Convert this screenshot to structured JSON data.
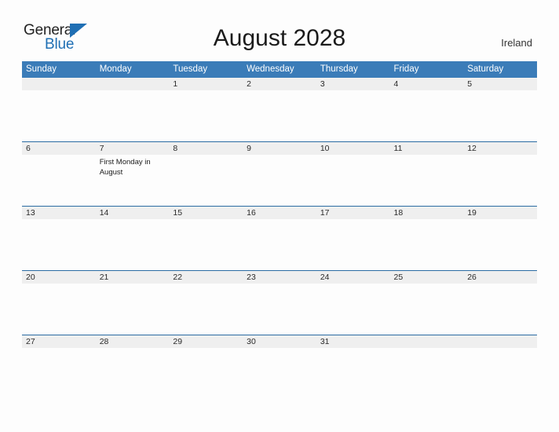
{
  "brand": {
    "name_part1": "General",
    "name_part2": "Blue",
    "triangle_color": "#1f6fb4"
  },
  "header": {
    "title": "August 2028",
    "region": "Ireland"
  },
  "theme": {
    "header_blue": "#3b7cb8",
    "rule_blue": "#2b6ca3",
    "band_gray": "#efefef",
    "page_background": "#fdfdfd"
  },
  "calendar": {
    "weekday_headers": [
      "Sunday",
      "Monday",
      "Tuesday",
      "Wednesday",
      "Thursday",
      "Friday",
      "Saturday"
    ],
    "weeks": [
      [
        {
          "date": "",
          "events": []
        },
        {
          "date": "",
          "events": []
        },
        {
          "date": "1",
          "events": []
        },
        {
          "date": "2",
          "events": []
        },
        {
          "date": "3",
          "events": []
        },
        {
          "date": "4",
          "events": []
        },
        {
          "date": "5",
          "events": []
        }
      ],
      [
        {
          "date": "6",
          "events": []
        },
        {
          "date": "7",
          "events": [
            "First Monday in August"
          ]
        },
        {
          "date": "8",
          "events": []
        },
        {
          "date": "9",
          "events": []
        },
        {
          "date": "10",
          "events": []
        },
        {
          "date": "11",
          "events": []
        },
        {
          "date": "12",
          "events": []
        }
      ],
      [
        {
          "date": "13",
          "events": []
        },
        {
          "date": "14",
          "events": []
        },
        {
          "date": "15",
          "events": []
        },
        {
          "date": "16",
          "events": []
        },
        {
          "date": "17",
          "events": []
        },
        {
          "date": "18",
          "events": []
        },
        {
          "date": "19",
          "events": []
        }
      ],
      [
        {
          "date": "20",
          "events": []
        },
        {
          "date": "21",
          "events": []
        },
        {
          "date": "22",
          "events": []
        },
        {
          "date": "23",
          "events": []
        },
        {
          "date": "24",
          "events": []
        },
        {
          "date": "25",
          "events": []
        },
        {
          "date": "26",
          "events": []
        }
      ],
      [
        {
          "date": "27",
          "events": []
        },
        {
          "date": "28",
          "events": []
        },
        {
          "date": "29",
          "events": []
        },
        {
          "date": "30",
          "events": []
        },
        {
          "date": "31",
          "events": []
        },
        {
          "date": "",
          "events": []
        },
        {
          "date": "",
          "events": []
        }
      ]
    ]
  }
}
